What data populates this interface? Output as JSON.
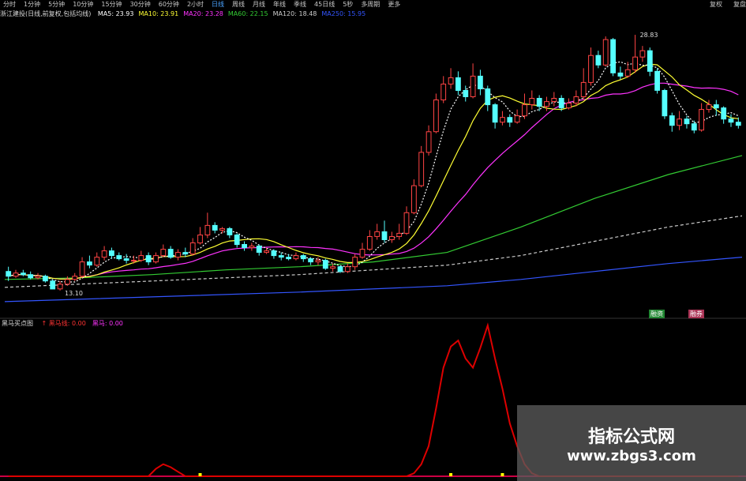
{
  "toolbar": {
    "tabs": [
      "分时",
      "1分钟",
      "5分钟",
      "10分钟",
      "15分钟",
      "30分钟",
      "60分钟",
      "2小时",
      "日线",
      "周线",
      "月线",
      "年线",
      "季线",
      "45日线",
      "5秒",
      "多周期",
      "更多"
    ],
    "active_tab": "日线",
    "right": [
      "复权",
      "复盘"
    ]
  },
  "ma_legend": {
    "title": "浙江建投(日线,前复权,包括均线)",
    "items": [
      {
        "label": "MA5: 23.93",
        "color": "#ffffff"
      },
      {
        "label": "MA10: 23.91",
        "color": "#ffff33"
      },
      {
        "label": "MA20: 23.28",
        "color": "#ff33ff"
      },
      {
        "label": "MA60: 22.15",
        "color": "#33cc33"
      },
      {
        "label": "MA120: 18.48",
        "color": "#cccccc"
      },
      {
        "label": "MA250: 15.95",
        "color": "#3355ff"
      }
    ]
  },
  "price_annotations": {
    "high": "28.83",
    "low": "13.10"
  },
  "buttons": {
    "left_btn": "融资",
    "right_btn": "融券"
  },
  "indicator": {
    "name": "黑马买点图",
    "items": [
      {
        "label": "↑ 黑马线: 0.00",
        "color": "#ff3333"
      },
      {
        "label": "黑马: 0.00",
        "color": "#ff33ff"
      }
    ]
  },
  "watermark": {
    "title": "指标公式网",
    "url": "www.zbgs3.com"
  },
  "colors": {
    "up": "#ff4444",
    "down": "#55ffff",
    "signal": "#dd0000",
    "marker": "#ffff00"
  },
  "candles": [
    [
      14.2,
      13.9,
      14.5,
      13.6
    ],
    [
      13.9,
      14.1,
      14.3,
      13.8
    ],
    [
      14.1,
      14.0,
      14.3,
      13.9
    ],
    [
      14.0,
      13.8,
      14.2,
      13.7
    ],
    [
      13.8,
      13.9,
      14.1,
      13.7
    ],
    [
      13.9,
      13.6,
      14.0,
      13.5
    ],
    [
      13.6,
      13.1,
      13.7,
      13.1
    ],
    [
      13.1,
      13.4,
      13.6,
      13.0
    ],
    [
      13.4,
      13.7,
      13.9,
      13.3
    ],
    [
      13.7,
      13.9,
      14.1,
      13.6
    ],
    [
      13.9,
      14.8,
      15.1,
      13.8
    ],
    [
      14.8,
      14.6,
      15.2,
      14.4
    ],
    [
      14.6,
      15.1,
      15.4,
      14.5
    ],
    [
      15.1,
      15.5,
      15.8,
      14.9
    ],
    [
      15.5,
      15.2,
      15.7,
      15.0
    ],
    [
      15.2,
      15.0,
      15.4,
      14.9
    ],
    [
      15.0,
      14.9,
      15.3,
      14.7
    ],
    [
      14.9,
      14.9,
      15.2,
      14.7
    ],
    [
      14.9,
      15.2,
      15.5,
      14.8
    ],
    [
      15.2,
      14.8,
      15.4,
      14.6
    ],
    [
      14.8,
      15.2,
      15.4,
      14.7
    ],
    [
      15.2,
      15.6,
      15.9,
      15.1
    ],
    [
      15.6,
      15.1,
      15.8,
      15.0
    ],
    [
      15.1,
      15.4,
      15.6,
      14.9
    ],
    [
      15.4,
      15.3,
      15.7,
      15.1
    ],
    [
      15.3,
      16.0,
      16.3,
      15.2
    ],
    [
      16.0,
      16.5,
      17.0,
      15.9
    ],
    [
      16.5,
      17.1,
      17.9,
      16.3
    ],
    [
      17.1,
      16.8,
      17.3,
      16.6
    ],
    [
      16.8,
      16.9,
      17.0,
      16.6
    ],
    [
      16.9,
      16.5,
      17.0,
      16.3
    ],
    [
      16.5,
      15.9,
      16.6,
      15.7
    ],
    [
      15.9,
      15.7,
      16.1,
      15.5
    ],
    [
      15.7,
      15.8,
      16.0,
      15.5
    ],
    [
      15.8,
      15.4,
      15.9,
      15.2
    ],
    [
      15.4,
      15.5,
      15.7,
      15.3
    ],
    [
      15.5,
      15.2,
      15.6,
      15.0
    ],
    [
      15.2,
      15.1,
      15.4,
      14.9
    ],
    [
      15.1,
      15.0,
      15.3,
      14.9
    ],
    [
      15.0,
      15.2,
      15.4,
      14.9
    ],
    [
      15.2,
      15.0,
      15.3,
      14.8
    ],
    [
      15.0,
      14.8,
      15.1,
      14.6
    ],
    [
      14.8,
      14.9,
      15.1,
      14.6
    ],
    [
      14.9,
      14.4,
      15.0,
      14.3
    ],
    [
      14.4,
      14.5,
      14.7,
      14.2
    ],
    [
      14.5,
      14.2,
      14.6,
      14.1
    ],
    [
      14.2,
      14.5,
      14.7,
      14.1
    ],
    [
      14.5,
      15.1,
      15.3,
      14.3
    ],
    [
      15.1,
      15.6,
      16.0,
      15.0
    ],
    [
      15.6,
      16.4,
      16.8,
      15.5
    ],
    [
      16.4,
      16.7,
      17.2,
      16.2
    ],
    [
      16.7,
      16.2,
      17.4,
      16.0
    ],
    [
      16.2,
      16.4,
      16.7,
      16.0
    ],
    [
      16.4,
      16.6,
      17.2,
      16.2
    ],
    [
      16.6,
      17.9,
      18.3,
      16.5
    ],
    [
      17.9,
      19.6,
      20.0,
      17.8
    ],
    [
      19.6,
      21.7,
      22.1,
      19.5
    ],
    [
      21.7,
      23.0,
      23.4,
      21.5
    ],
    [
      23.0,
      25.0,
      25.4,
      22.9
    ],
    [
      25.0,
      26.0,
      26.5,
      24.8
    ],
    [
      26.0,
      26.4,
      27.0,
      25.7
    ],
    [
      26.4,
      25.6,
      26.8,
      25.3
    ],
    [
      25.6,
      25.2,
      25.9,
      24.9
    ],
    [
      25.2,
      26.5,
      27.3,
      25.1
    ],
    [
      26.5,
      25.7,
      26.9,
      25.3
    ],
    [
      25.7,
      24.7,
      25.9,
      24.3
    ],
    [
      24.7,
      23.6,
      24.8,
      23.2
    ],
    [
      23.6,
      23.9,
      24.3,
      23.4
    ],
    [
      23.9,
      23.6,
      24.1,
      23.3
    ],
    [
      23.6,
      24.0,
      24.4,
      23.5
    ],
    [
      24.0,
      24.7,
      25.4,
      23.8
    ],
    [
      24.7,
      25.1,
      25.6,
      24.4
    ],
    [
      25.1,
      24.6,
      25.3,
      24.3
    ],
    [
      24.6,
      24.9,
      25.2,
      24.3
    ],
    [
      24.9,
      25.1,
      25.5,
      24.6
    ],
    [
      25.1,
      24.5,
      25.3,
      24.3
    ],
    [
      24.5,
      24.8,
      25.1,
      24.4
    ],
    [
      24.8,
      25.2,
      25.6,
      24.6
    ],
    [
      25.2,
      26.1,
      27.0,
      25.0
    ],
    [
      26.1,
      27.8,
      28.3,
      25.9
    ],
    [
      27.8,
      27.2,
      28.1,
      27.0
    ],
    [
      27.2,
      28.8,
      29.0,
      27.1
    ],
    [
      28.8,
      26.7,
      28.9,
      26.5
    ],
    [
      26.7,
      26.5,
      27.1,
      26.3
    ],
    [
      26.5,
      26.9,
      27.4,
      26.4
    ],
    [
      26.9,
      27.7,
      29.1,
      26.7
    ],
    [
      27.7,
      28.1,
      28.4,
      27.4
    ],
    [
      28.1,
      26.8,
      28.3,
      26.5
    ],
    [
      26.8,
      25.6,
      27.0,
      25.4
    ],
    [
      25.6,
      24.0,
      25.7,
      23.8
    ],
    [
      24.0,
      23.4,
      24.2,
      23.0
    ],
    [
      23.4,
      23.8,
      24.3,
      23.1
    ],
    [
      23.8,
      23.5,
      24.0,
      23.2
    ],
    [
      23.5,
      23.1,
      23.7,
      22.9
    ],
    [
      23.1,
      24.4,
      24.8,
      23.0
    ],
    [
      24.4,
      24.7,
      25.0,
      24.2
    ],
    [
      24.7,
      24.5,
      25.0,
      24.0
    ],
    [
      24.5,
      23.8,
      24.6,
      23.5
    ],
    [
      23.8,
      23.6,
      24.1,
      23.3
    ],
    [
      23.6,
      23.4,
      23.9,
      23.2
    ]
  ],
  "ma60": [
    [
      0,
      13.7
    ],
    [
      10,
      13.8
    ],
    [
      20,
      14.0
    ],
    [
      30,
      14.3
    ],
    [
      40,
      14.5
    ],
    [
      50,
      14.8
    ],
    [
      60,
      15.4
    ],
    [
      70,
      17.0
    ],
    [
      80,
      18.8
    ],
    [
      90,
      20.3
    ],
    [
      100,
      21.5
    ]
  ],
  "ma120": [
    [
      0,
      13.2
    ],
    [
      20,
      13.6
    ],
    [
      40,
      14.0
    ],
    [
      60,
      14.6
    ],
    [
      70,
      15.2
    ],
    [
      80,
      16.1
    ],
    [
      90,
      17.0
    ],
    [
      100,
      17.7
    ]
  ],
  "ma250": [
    [
      0,
      12.3
    ],
    [
      20,
      12.6
    ],
    [
      40,
      12.9
    ],
    [
      60,
      13.3
    ],
    [
      70,
      13.7
    ],
    [
      80,
      14.2
    ],
    [
      90,
      14.7
    ],
    [
      100,
      15.1
    ]
  ],
  "signal": [
    0,
    0,
    0,
    0,
    0,
    0,
    0,
    0,
    0,
    0,
    0,
    0,
    0,
    0,
    0,
    0,
    0,
    0,
    0,
    0,
    0.05,
    0.08,
    0.06,
    0.03,
    0,
    0,
    0,
    0,
    0,
    0,
    0,
    0,
    0,
    0,
    0,
    0,
    0,
    0,
    0,
    0,
    0,
    0,
    0,
    0,
    0,
    0,
    0,
    0,
    0,
    0,
    0,
    0,
    0,
    0,
    0,
    0.02,
    0.08,
    0.2,
    0.45,
    0.72,
    0.86,
    0.9,
    0.78,
    0.72,
    0.85,
    1.0,
    0.78,
    0.58,
    0.35,
    0.2,
    0.08,
    0.02,
    0,
    0,
    0,
    0,
    0,
    0,
    0,
    0,
    0,
    0,
    0,
    0,
    0,
    0,
    0,
    0,
    0,
    0,
    0,
    0,
    0,
    0,
    0,
    0,
    0,
    0,
    0,
    0
  ],
  "markers": [
    26,
    60,
    67
  ]
}
